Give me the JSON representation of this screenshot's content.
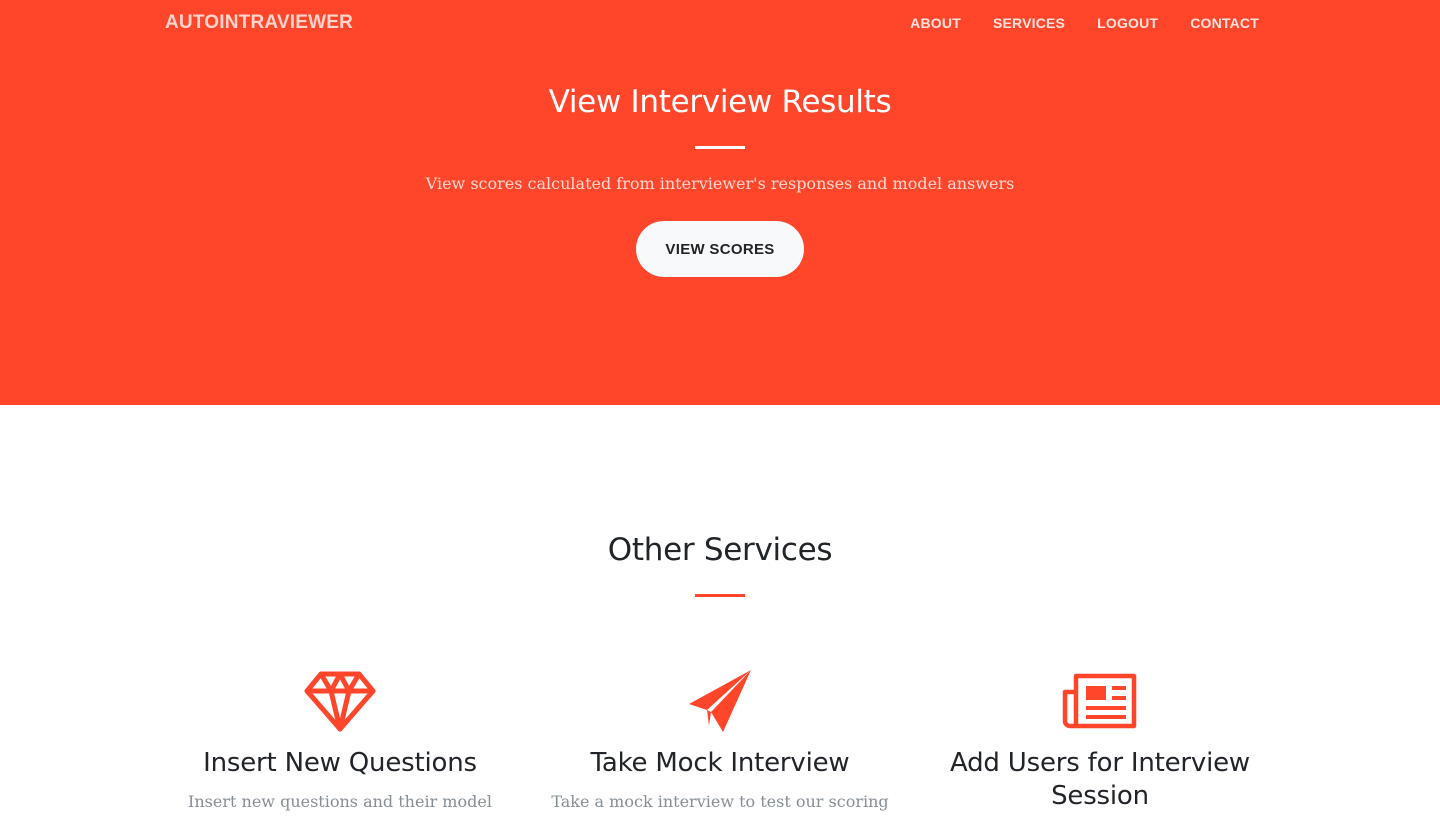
{
  "nav": {
    "brand": "AUTOINTRAVIEWER",
    "links": [
      "ABOUT",
      "SERVICES",
      "LOGOUT",
      "CONTACT"
    ]
  },
  "hero": {
    "title": "View Interview Results",
    "subtitle": "View scores calculated from interviewer's responses and model answers",
    "button": "VIEW SCORES"
  },
  "services": {
    "title": "Other Services",
    "items": [
      {
        "icon": "diamond-icon",
        "title": "Insert New Questions",
        "text": "Insert new questions and their model"
      },
      {
        "icon": "paper-plane-icon",
        "title": "Take Mock Interview",
        "text": "Take a mock interview to test our scoring"
      },
      {
        "icon": "newspaper-icon",
        "title": "Add Users for Interview Session",
        "text": ""
      }
    ]
  },
  "colors": {
    "accent": "#ff462b",
    "button_bg": "#f8f9fa",
    "text_dark": "#212529",
    "text_muted": "#868e96"
  }
}
